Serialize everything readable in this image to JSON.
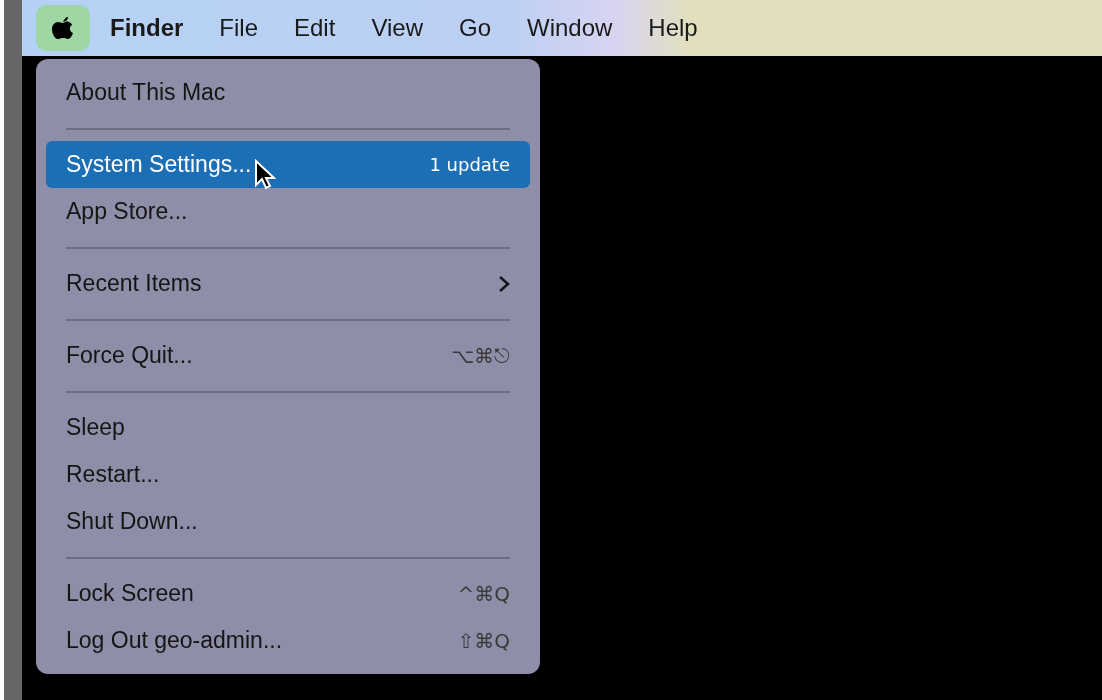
{
  "menu_bar": [
    {
      "kind": "apple",
      "selected": true
    },
    {
      "kind": "app",
      "label": "Finder",
      "selected": false
    },
    {
      "kind": "menu",
      "label": "File",
      "selected": false
    },
    {
      "kind": "menu",
      "label": "Edit",
      "selected": false
    },
    {
      "kind": "menu",
      "label": "View",
      "selected": false
    },
    {
      "kind": "menu",
      "label": "Go",
      "selected": false
    },
    {
      "kind": "menu",
      "label": "Window",
      "selected": false
    },
    {
      "kind": "menu",
      "label": "Help",
      "selected": false
    }
  ],
  "apple_menu": [
    {
      "kind": "item",
      "label": "About This Mac",
      "selected": false
    },
    {
      "kind": "separator"
    },
    {
      "kind": "item",
      "label": "System Settings...",
      "badge": "1 update",
      "selected": true
    },
    {
      "kind": "item",
      "label": "App Store...",
      "selected": false
    },
    {
      "kind": "separator"
    },
    {
      "kind": "submenu",
      "label": "Recent Items",
      "selected": false
    },
    {
      "kind": "separator"
    },
    {
      "kind": "item",
      "label": "Force Quit...",
      "shortcut": "⌥⌘⎋",
      "selected": false
    },
    {
      "kind": "separator"
    },
    {
      "kind": "item",
      "label": "Sleep",
      "selected": false
    },
    {
      "kind": "item",
      "label": "Restart...",
      "selected": false
    },
    {
      "kind": "item",
      "label": "Shut Down...",
      "selected": false
    },
    {
      "kind": "separator"
    },
    {
      "kind": "item",
      "label": "Lock Screen",
      "shortcut": "^⌘Q",
      "selected": false
    },
    {
      "kind": "item",
      "label": "Log Out geo-admin...",
      "shortcut": "⇧⌘Q",
      "selected": false
    }
  ]
}
